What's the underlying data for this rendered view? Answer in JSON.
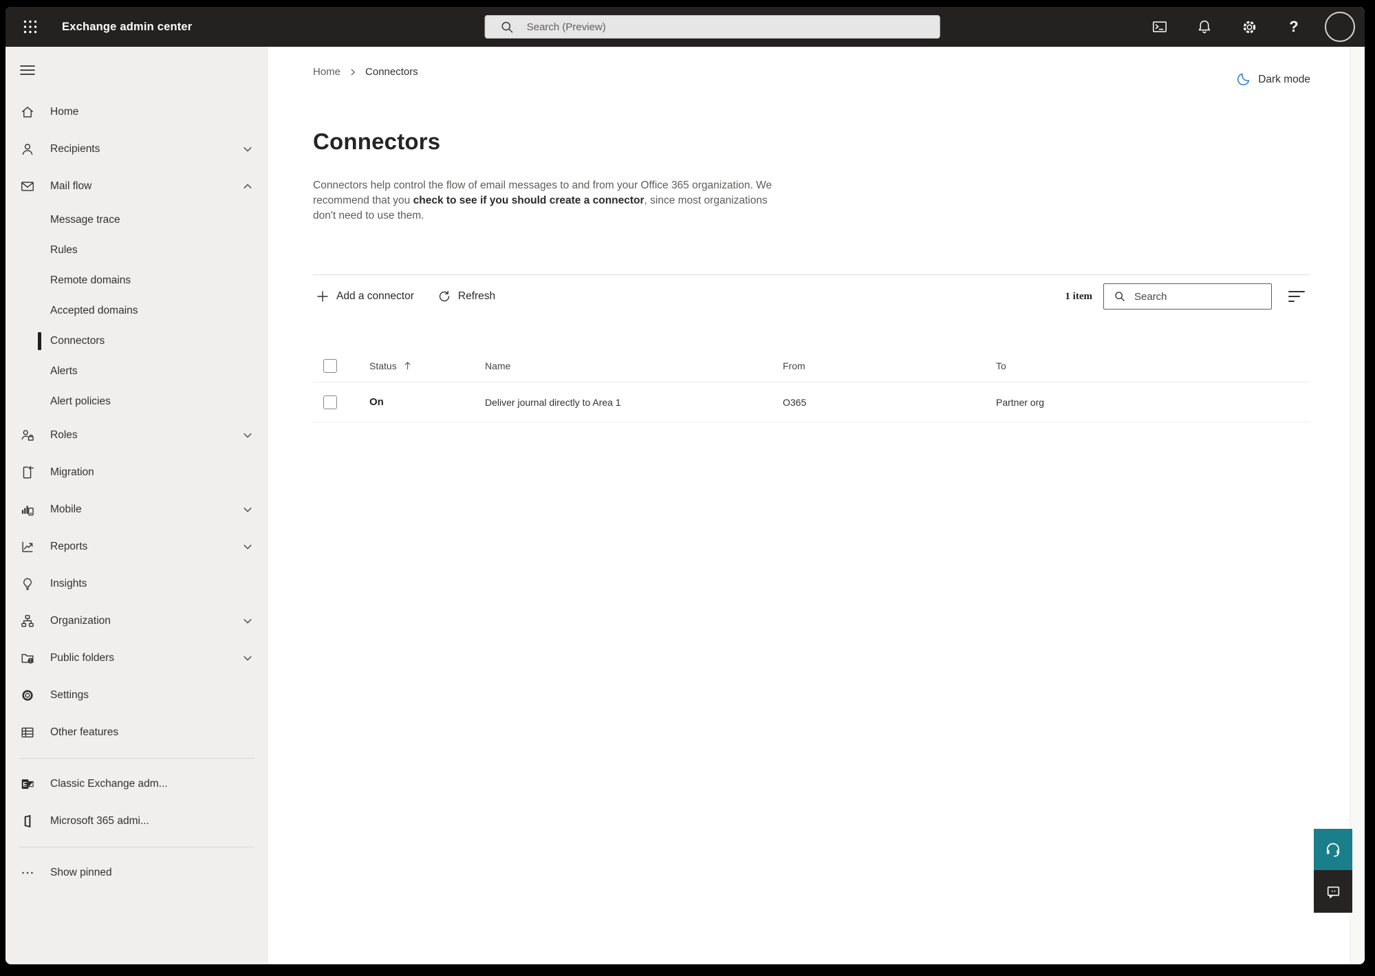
{
  "topbar": {
    "app_title": "Exchange admin center",
    "search_placeholder": "Search (Preview)"
  },
  "sidebar": {
    "items": [
      {
        "label": "Home",
        "icon": "home-icon"
      },
      {
        "label": "Recipients",
        "icon": "person-icon",
        "chevron": "down"
      },
      {
        "label": "Mail flow",
        "icon": "mail-icon",
        "chevron": "up",
        "expanded": true
      },
      {
        "label": "Message trace"
      },
      {
        "label": "Rules"
      },
      {
        "label": "Remote domains"
      },
      {
        "label": "Accepted domains"
      },
      {
        "label": "Connectors",
        "selected": true
      },
      {
        "label": "Alerts"
      },
      {
        "label": "Alert policies"
      },
      {
        "label": "Roles",
        "icon": "roles-icon",
        "chevron": "down"
      },
      {
        "label": "Migration",
        "icon": "migration-icon"
      },
      {
        "label": "Mobile",
        "icon": "mobile-icon",
        "chevron": "down"
      },
      {
        "label": "Reports",
        "icon": "reports-icon",
        "chevron": "down"
      },
      {
        "label": "Insights",
        "icon": "lightbulb-icon"
      },
      {
        "label": "Organization",
        "icon": "org-chart-icon",
        "chevron": "down"
      },
      {
        "label": "Public folders",
        "icon": "folder-globe-icon",
        "chevron": "down"
      },
      {
        "label": "Settings",
        "icon": "gear-icon"
      },
      {
        "label": "Other features",
        "icon": "table-grid-icon"
      },
      {
        "label": "Classic Exchange adm...",
        "icon": "exchange-logo-icon"
      },
      {
        "label": "Microsoft 365 admi...",
        "icon": "office-logo-icon"
      },
      {
        "label": "Show pinned",
        "icon": "ellipsis-icon"
      }
    ]
  },
  "breadcrumb": {
    "items": [
      "Home",
      "Connectors"
    ]
  },
  "dark_mode": {
    "label": "Dark mode"
  },
  "page": {
    "title": "Connectors",
    "description_parts": [
      "Connectors help control the flow of email messages to and from your Office 365 organization. We recommend that you ",
      "check to see if you should create a connector",
      ", since most organizations don't need to use them."
    ]
  },
  "toolbar": {
    "add_label": "Add a connector",
    "refresh_label": "Refresh",
    "item_count": "1 item",
    "search_placeholder": "Search"
  },
  "table": {
    "columns": [
      "Status",
      "Name",
      "From",
      "To"
    ],
    "sorted_column": "Status",
    "sort_direction": "ascending",
    "rows": [
      {
        "status": "On",
        "name": "Deliver journal directly to Area 1",
        "from": "O365",
        "to": "Partner org"
      }
    ]
  },
  "icons": {
    "app-launcher-icon": "3x3 white dot grid",
    "search-icon": "magnifier",
    "terminal-icon": "command prompt window",
    "bell-icon": "notifications bell",
    "gear-icon": "settings gear",
    "help-icon": "question mark",
    "avatar": "empty account circle",
    "moon-icon": "blue crescent moon",
    "plus-icon": "add",
    "refresh-icon": "circular arrow",
    "filter-icon": "three shrinking lines",
    "sort-ascending-icon": "up arrow",
    "headset-icon": "support headset",
    "feedback-icon": "speech bubble"
  },
  "colors": {
    "topbar_bg": "#232221",
    "sidebar_bg": "#f0efed",
    "accent_blue": "#2b7cd3",
    "help_teal": "#1b7f8b",
    "feedback_dark": "#252423"
  }
}
